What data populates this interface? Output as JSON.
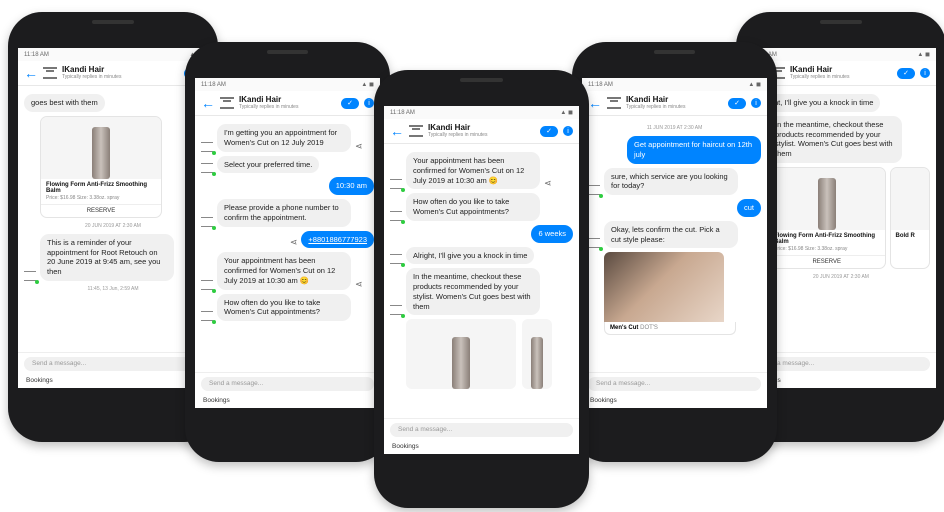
{
  "header": {
    "name": "IKandi Hair",
    "subtitle": "Typically replies in minutes",
    "ok_icon": "check-icon",
    "info_icon": "info-icon"
  },
  "footer": {
    "placeholder": "Send a message...",
    "bookings": "Bookings"
  },
  "phone1": {
    "status_time": "11:18 AM",
    "top_text": "goes best with them",
    "card_title": "Flowing Form Anti-Frizz Smoothing Balm",
    "card_price": "Price: $16.98 Size: 3.38oz. spray",
    "reserve": "RESERVE",
    "ts1": "20 JUN 2019 AT 2:30 AM",
    "reminder": "This is a reminder of your appointment for Root Retouch on 20 June 2019 at 9:45 am, see you then",
    "ts2": "11:45, 13 Jun, 2:59 AM"
  },
  "phone2": {
    "status_time": "11:18 AM",
    "m1": "I'm getting you an appointment for Women's Cut on 12 July 2019",
    "m2": "Select your preferred time.",
    "m3": "10:30 am",
    "m4": "Please provide a phone number to confirm the appointment.",
    "m5": "+8801886777923",
    "m6": "Your appointment has been confirmed for Women's Cut on 12 July 2019 at 10:30 am 😊",
    "m7": "How often do you like to take Women's Cut appointments?"
  },
  "phone3": {
    "status_time": "11:18 AM",
    "m0": "Your appointment has been confirmed for Women's Cut on 12 July 2019 at 10:30 am 😊",
    "m1": "How often do you like to take Women's Cut appointments?",
    "m2": "6 weeks",
    "m3": "Alright, I'll give you a knock in time",
    "m4": "In the meantime, checkout these products recommended by your stylist. Women's Cut goes best with them"
  },
  "phone4": {
    "status_time": "11:18 AM",
    "ts": "11 JUN 2019 AT 2:30 AM",
    "m1": "Get appointment for haircut on 12th july",
    "m2": "sure, which service are you looking for today?",
    "m3": "cut",
    "m4": "Okay, lets confirm the cut. Pick a cut style please:",
    "card_label": "Men's Cut",
    "card_sub": "DOT'S"
  },
  "phone5": {
    "status_time": "11:18 AM",
    "m1": "Alright, I'll give you a knock in time",
    "m2": "In the meantime, checkout these products recommended by your stylist. Women's Cut goes best with them",
    "card_title": "Flowing Form Anti-Frizz Smoothing Balm",
    "card_price": "Price: $16.98 Size: 3.38oz. spray",
    "card2_title": "Bold R",
    "reserve": "RESERVE",
    "ts": "20 JUN 2019 AT 2:30 AM"
  }
}
